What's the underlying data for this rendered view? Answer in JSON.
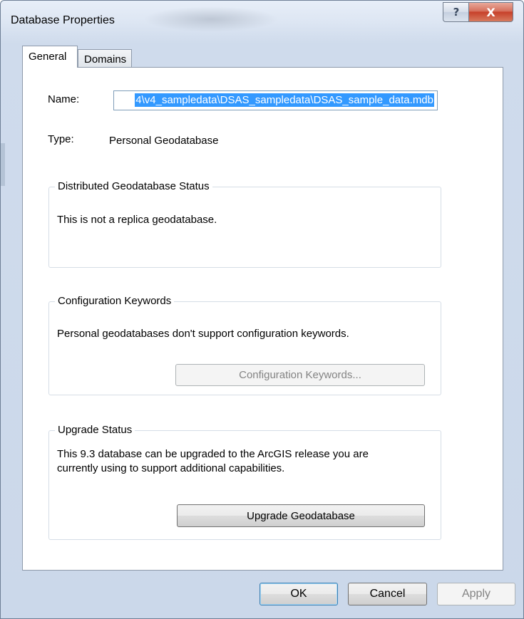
{
  "window": {
    "title": "Database Properties",
    "help_glyph": "?",
    "close_glyph": "X"
  },
  "tabs": [
    {
      "label": "General",
      "active": true
    },
    {
      "label": "Domains",
      "active": false
    }
  ],
  "general": {
    "name_label": "Name:",
    "name_value": "4\\v4_sampledata\\DSAS_sampledata\\DSAS_sample_data.mdb",
    "type_label": "Type:",
    "type_value": "Personal Geodatabase"
  },
  "distributed": {
    "title": "Distributed Geodatabase Status",
    "text": "This is not a replica geodatabase."
  },
  "config": {
    "title": "Configuration Keywords",
    "text": "Personal geodatabases don't support configuration keywords.",
    "button_label": "Configuration Keywords..."
  },
  "upgrade": {
    "title": "Upgrade Status",
    "text_line1": "This 9.3 database can be upgraded to the ArcGIS release you are",
    "text_line2": "currently using to support additional capabilities.",
    "button_label": "Upgrade Geodatabase"
  },
  "footer": {
    "ok_label": "OK",
    "cancel_label": "Cancel",
    "apply_label": "Apply"
  }
}
